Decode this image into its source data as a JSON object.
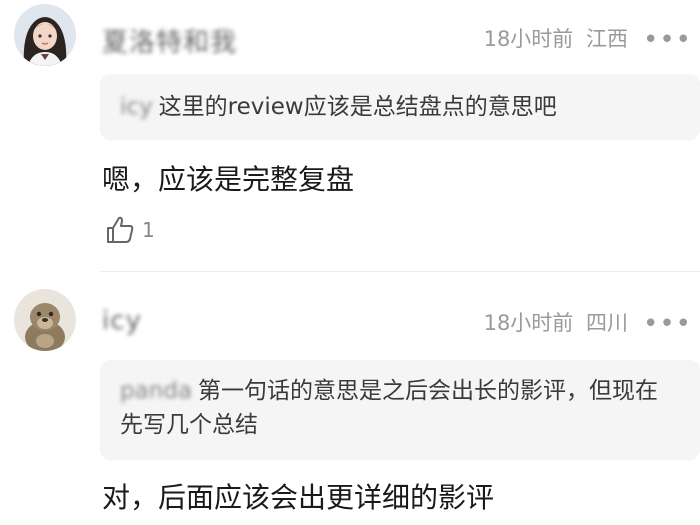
{
  "comments": [
    {
      "username": "夏洛特和我",
      "time": "18小时前",
      "location": "江西",
      "more_label": "•••",
      "quote_author": "icy",
      "quote_text": "这里的review应该是总结盘点的意思吧",
      "text": "嗯，应该是完整复盘",
      "like_count": "1"
    },
    {
      "username": "icy",
      "time": "18小时前",
      "location": "四川",
      "more_label": "•••",
      "quote_author": "panda",
      "quote_text": "第一句话的意思是之后会出长的影评，但现在先写几个总结",
      "text": "对，后面应该会出更详细的影评"
    }
  ]
}
